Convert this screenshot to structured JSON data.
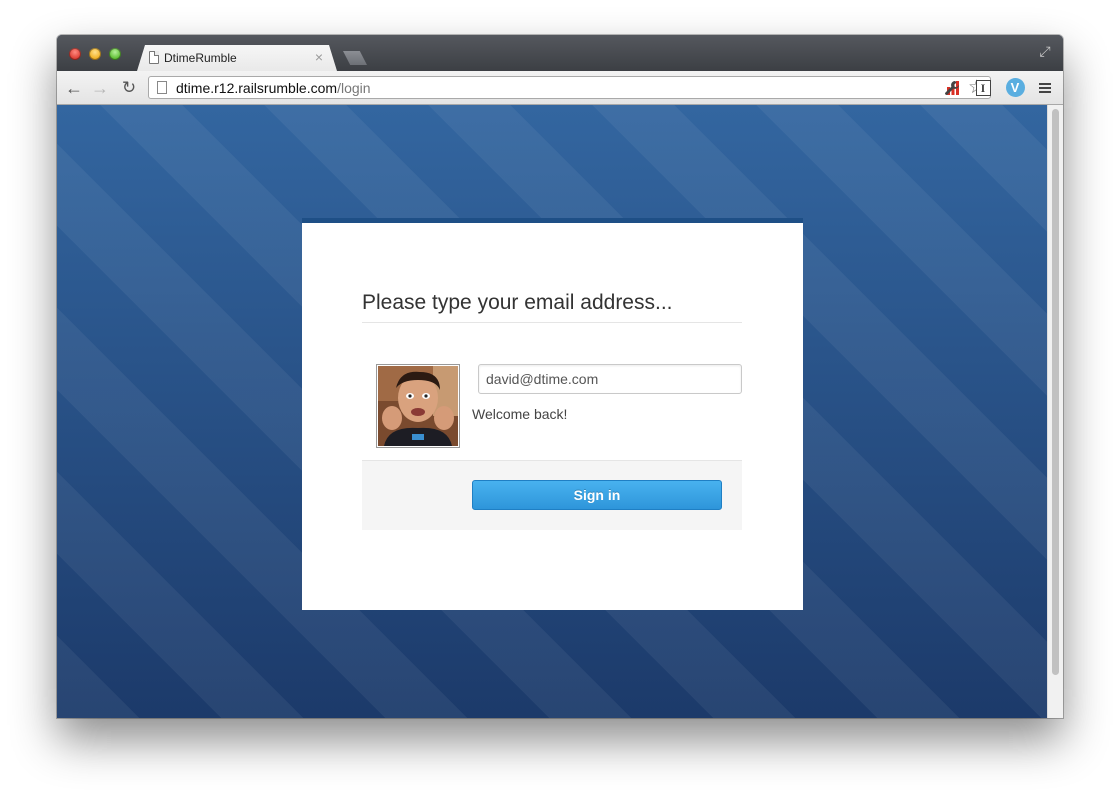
{
  "browser": {
    "tab_title": "DtimeRumble",
    "tab_close": "×",
    "url_host": "dtime.r12.railsrumble.com",
    "url_path": "/login",
    "back_glyph": "←",
    "forward_glyph": "→",
    "reload_glyph": "↻",
    "star_glyph": "☆",
    "wrench_glyph": "🔧",
    "instapaper_glyph": "I",
    "vimeo_glyph": "V",
    "fullscreen_glyph": "⤢"
  },
  "login": {
    "heading": "Please type your email address...",
    "email_value": "david@dtime.com",
    "welcome_text": "Welcome back!",
    "signin_label": "Sign in"
  },
  "colors": {
    "background_blue": "#2a5284",
    "card_top_border": "#1e4f86",
    "signin_button": "#3aa3e6"
  }
}
